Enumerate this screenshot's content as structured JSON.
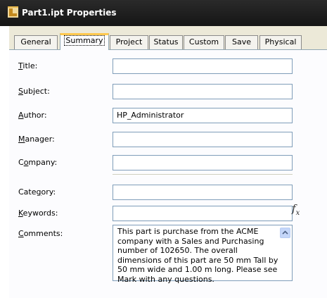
{
  "window": {
    "title": "Part1.ipt Properties"
  },
  "tabs": [
    {
      "label": "General"
    },
    {
      "label": "Summary"
    },
    {
      "label": "Project"
    },
    {
      "label": "Status"
    },
    {
      "label": "Custom"
    },
    {
      "label": "Save"
    },
    {
      "label": "Physical"
    }
  ],
  "active_tab": "Summary",
  "fields": {
    "title": {
      "label_pre": "",
      "label_key": "T",
      "label_post": "itle:",
      "value": ""
    },
    "subject": {
      "label_pre": "",
      "label_key": "S",
      "label_post": "ubject:",
      "value": ""
    },
    "author": {
      "label_pre": "",
      "label_key": "A",
      "label_post": "uthor:",
      "value": "HP_Administrator"
    },
    "manager": {
      "label_pre": "",
      "label_key": "M",
      "label_post": "anager:",
      "value": ""
    },
    "company": {
      "label_pre": "C",
      "label_key": "o",
      "label_post": "mpany:",
      "value": ""
    },
    "category": {
      "label_pre": "Cate",
      "label_key": "g",
      "label_post": "ory:",
      "value": ""
    },
    "keywords": {
      "label_pre": "",
      "label_key": "K",
      "label_post": "eywords:",
      "value": ""
    },
    "comments": {
      "label_pre": "",
      "label_key": "C",
      "label_post": "omments:",
      "value": "This part is purchase from the ACME company with a Sales and Purchasing number of 102650.  The overall dimensions of this part are 50 mm Tall by 50 mm wide and 1.00 m long. Please see Mark with any questions."
    }
  },
  "icons": {
    "title_icon": "inventor-part-icon",
    "function": "fx-icon",
    "scroll": "scroll-up-icon"
  },
  "fx_symbol": {
    "f": "f",
    "sub": "x"
  }
}
